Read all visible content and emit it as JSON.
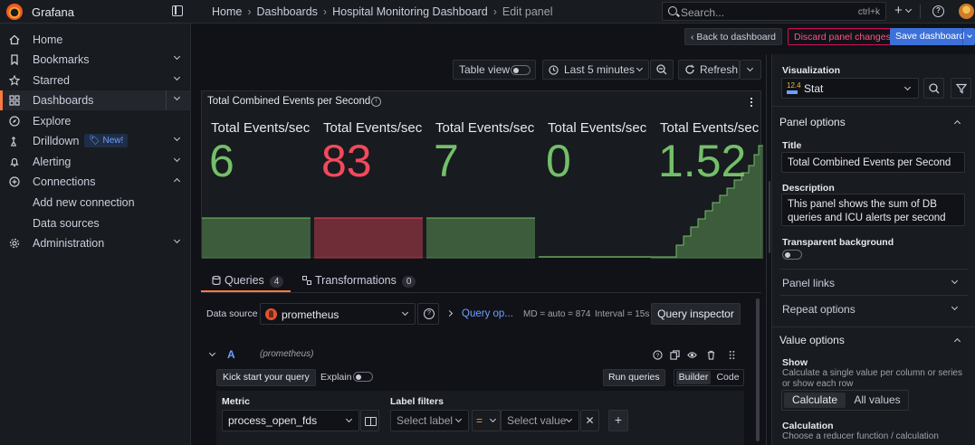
{
  "app": {
    "name": "Grafana"
  },
  "breadcrumbs": [
    "Home",
    "Dashboards",
    "Hospital Monitoring Dashboard",
    "Edit panel"
  ],
  "search": {
    "placeholder": "Search...",
    "shortcut": "ctrl+k"
  },
  "topbar": {
    "add_icon": "plus-icon",
    "help_icon": "help-icon"
  },
  "sidebar": {
    "items": [
      {
        "label": "Home",
        "icon": "home-icon",
        "active": false,
        "expand": "none"
      },
      {
        "label": "Bookmarks",
        "icon": "bookmark-icon",
        "active": false,
        "expand": "down"
      },
      {
        "label": "Starred",
        "icon": "star-icon",
        "active": false,
        "expand": "down"
      },
      {
        "label": "Dashboards",
        "icon": "dashboards-icon",
        "active": true,
        "expand": "down"
      },
      {
        "label": "Explore",
        "icon": "compass-icon",
        "active": false,
        "expand": "none"
      },
      {
        "label": "Drilldown",
        "icon": "drilldown-icon",
        "active": false,
        "expand": "down",
        "badge": "New!"
      },
      {
        "label": "Alerting",
        "icon": "bell-icon",
        "active": false,
        "expand": "down"
      },
      {
        "label": "Connections",
        "icon": "connections-icon",
        "active": false,
        "expand": "up"
      },
      {
        "label": "Add new connection",
        "icon": "",
        "active": false,
        "expand": "none"
      },
      {
        "label": "Data sources",
        "icon": "",
        "active": false,
        "expand": "none"
      },
      {
        "label": "Administration",
        "icon": "gear-icon",
        "active": false,
        "expand": "down"
      }
    ]
  },
  "actions": {
    "back": "Back to dashboard",
    "discard": "Discard panel changes",
    "save": "Save dashboard"
  },
  "toolbar": {
    "table_view": "Table view",
    "time_range": "Last 5 minutes",
    "refresh": "Refresh"
  },
  "panel": {
    "title": "Total Combined Events per Second",
    "stats": [
      {
        "label": "Total Events/sec",
        "value": "6",
        "color": "#73bf69"
      },
      {
        "label": "Total Events/sec",
        "value": "83",
        "color": "#f2495c"
      },
      {
        "label": "Total Events/sec",
        "value": "7",
        "color": "#73bf69"
      },
      {
        "label": "Total Events/sec",
        "value": "0",
        "color": "#73bf69"
      },
      {
        "label": "Total Events/sec",
        "value": "1.52",
        "color": "#73bf69"
      }
    ],
    "colors": {
      "green": "#73bf69",
      "red": "#f2495c"
    }
  },
  "query_tabs": [
    {
      "label": "Queries",
      "count": "4"
    },
    {
      "label": "Transformations",
      "count": "0"
    }
  ],
  "datasource": {
    "label": "Data source",
    "value": "prometheus",
    "query_options": "Query op...",
    "md": "MD = auto = 874",
    "interval": "Interval = 15s",
    "inspector": "Query inspector"
  },
  "query": {
    "ref": "A",
    "datasource": "(prometheus)",
    "kick_start": "Kick start your query",
    "explain": "Explain",
    "run": "Run queries",
    "mode_builder": "Builder",
    "mode_code": "Code",
    "metric_label": "Metric",
    "metric_value": "process_open_fds",
    "label_filters": "Label filters",
    "select_label": "Select label",
    "operator": "=",
    "select_value": "Select value"
  },
  "options": {
    "visualization_heading": "Visualization",
    "visualization": "Stat",
    "panel_options": "Panel options",
    "title_label": "Title",
    "title_value": "Total Combined Events per Second",
    "description_label": "Description",
    "description_value": "This panel shows the sum of DB queries and ICU alerts per second",
    "transparent_label": "Transparent background",
    "panel_links": "Panel links",
    "repeat_options": "Repeat options",
    "value_options": "Value options",
    "show_label": "Show",
    "show_desc": "Calculate a single value per column or series or show each row",
    "calculate": "Calculate",
    "all_values": "All values",
    "calculation_label": "Calculation",
    "calculation_desc": "Choose a reducer function / calculation"
  }
}
